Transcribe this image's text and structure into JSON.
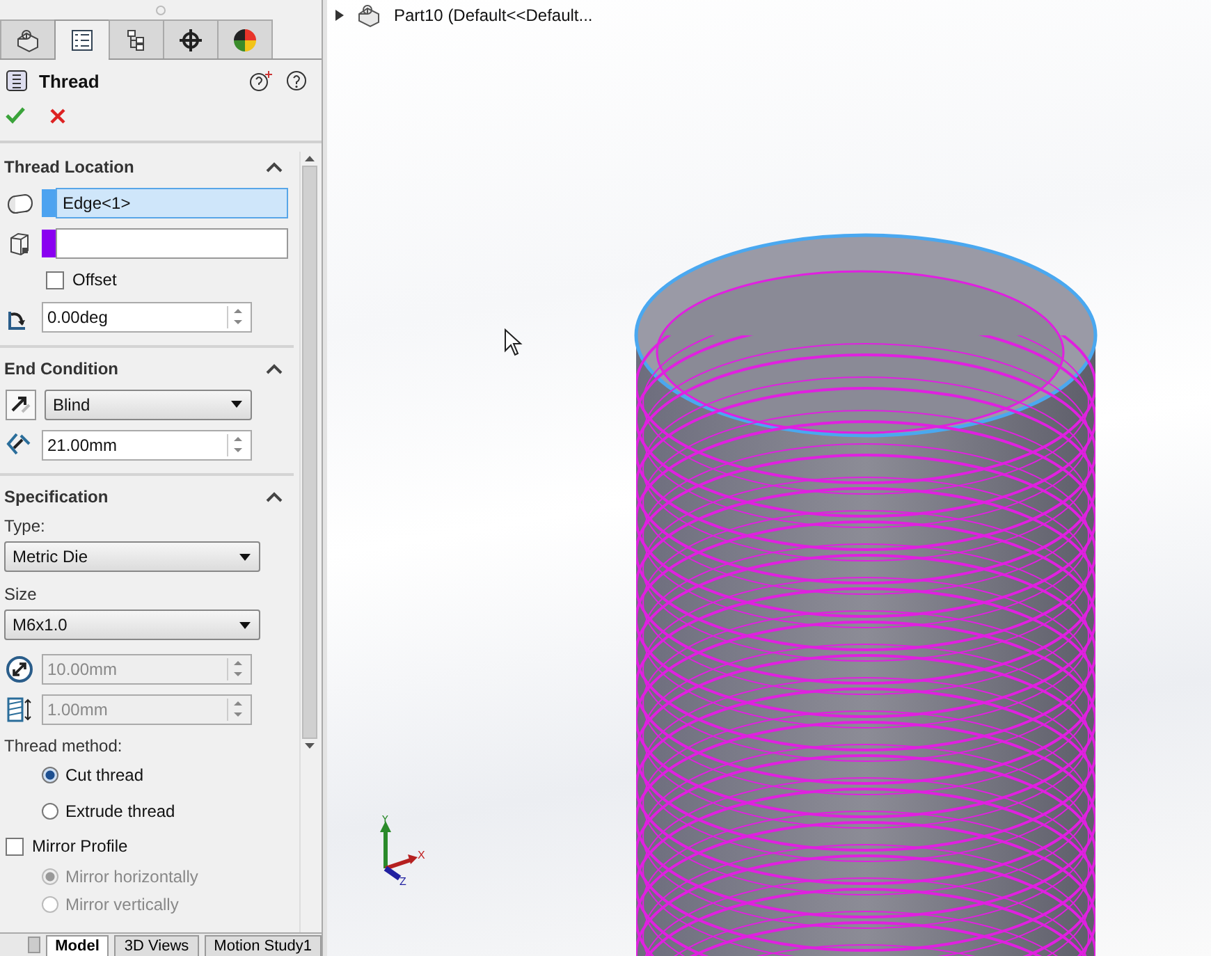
{
  "panel_tabs": [
    {
      "selected": false
    },
    {
      "selected": true
    },
    {
      "selected": false
    },
    {
      "selected": false
    },
    {
      "selected": false
    }
  ],
  "feature": {
    "title": "Thread"
  },
  "thread_location": {
    "title": "Thread Location",
    "expanded": true,
    "edge_field": {
      "color": "#4da3f0",
      "value": "Edge<1>",
      "selected": true
    },
    "face_field": {
      "color": "#8a00f0",
      "selected": false
    },
    "offset": {
      "label": "Offset",
      "checked": false
    },
    "angle": {
      "value": "0.00deg",
      "disabled": false
    }
  },
  "end_condition": {
    "title": "End Condition",
    "expanded": true,
    "type": {
      "value": "Blind"
    },
    "depth": {
      "value": "21.00mm",
      "disabled": false
    }
  },
  "specification": {
    "title": "Specification",
    "expanded": true,
    "type_label": "Type:",
    "type": {
      "value": "Metric Die"
    },
    "size_label": "Size",
    "size": {
      "value": "M6x1.0"
    },
    "diameter": {
      "value": "10.00mm",
      "disabled": true
    },
    "pitch": {
      "value": "1.00mm",
      "disabled": true
    },
    "method_label": "Thread method:",
    "methods": [
      {
        "label": "Cut thread",
        "selected": true,
        "disabled": false
      },
      {
        "label": "Extrude thread",
        "selected": false,
        "disabled": false
      }
    ],
    "mirror": {
      "label": "Mirror Profile",
      "checked": false
    },
    "mirror_options": [
      {
        "label": "Mirror horizontally",
        "selected": true,
        "disabled": true
      },
      {
        "label": "Mirror vertically",
        "selected": false,
        "disabled": true
      }
    ]
  },
  "tree": {
    "label": "Part10  (Default<<Default..."
  },
  "triad": {
    "x": "X",
    "y": "Y",
    "z": "Z"
  },
  "bottom_tabs": [
    {
      "label": "Model",
      "selected": true
    },
    {
      "label": "3D Views",
      "selected": false
    },
    {
      "label": "Motion Study1",
      "selected": false
    }
  ]
}
